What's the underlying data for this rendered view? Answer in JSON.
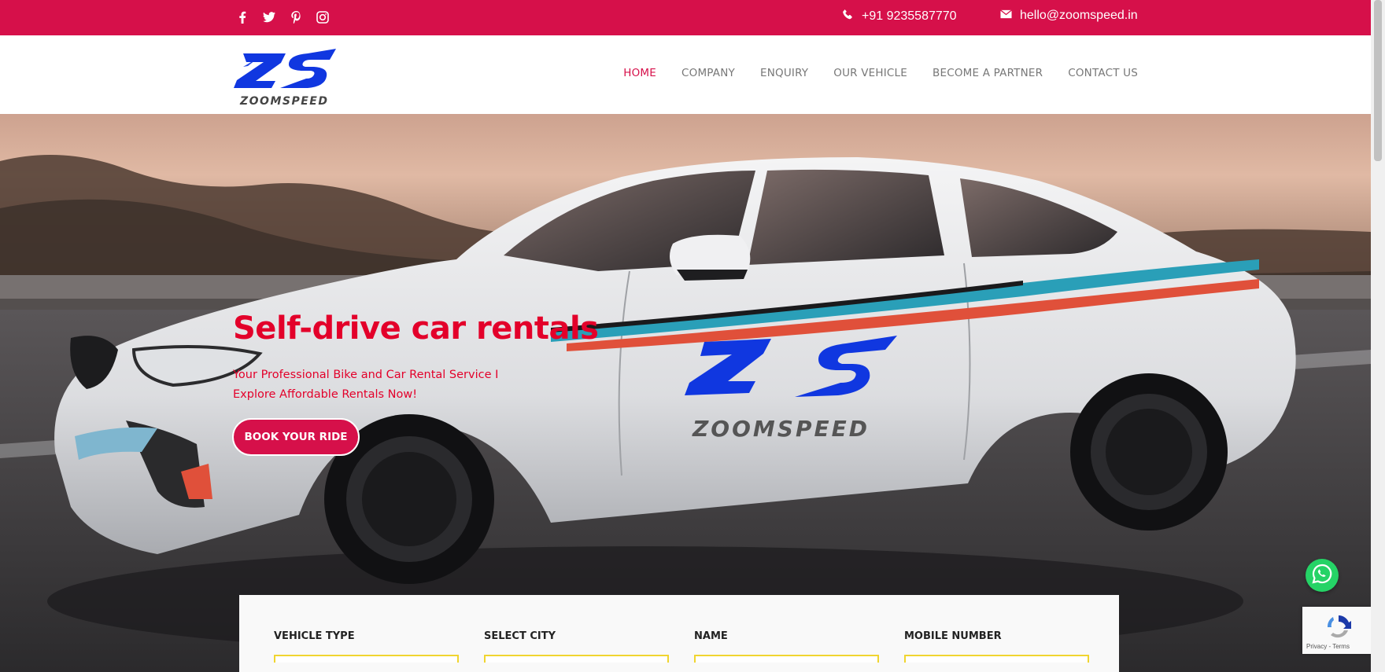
{
  "topbar": {
    "social": [
      {
        "name": "facebook-icon",
        "glyph": "f"
      },
      {
        "name": "twitter-icon",
        "glyph": ""
      },
      {
        "name": "pinterest-icon",
        "glyph": ""
      },
      {
        "name": "instagram-icon",
        "glyph": ""
      }
    ],
    "phone": "+91 9235587770",
    "email": "hello@zoomspeed.in"
  },
  "header": {
    "logo_mark": "ZS",
    "logo_wordmark": "ZOOMSPEED",
    "nav": [
      "HOME",
      "COMPANY",
      "ENQUIRY",
      "OUR VEHICLE",
      "BECOME A PARTNER",
      "CONTACT US"
    ],
    "active_nav": "HOME"
  },
  "hero": {
    "title": "Self-drive car rentals",
    "subtitle_line1": "Your Professional Bike and Car Rental Service I",
    "subtitle_line2": "Explore Affordable Rentals Now!",
    "cta": "BOOK YOUR RIDE",
    "car_logo_mark": "ZS",
    "car_logo_wordmark": "ZOOMSPEED"
  },
  "form": {
    "fields": [
      "VEHICLE TYPE",
      "SELECT CITY",
      "NAME",
      "MOBILE NUMBER"
    ]
  },
  "widgets": {
    "recaptcha_text": "Privacy - Terms"
  },
  "colors": {
    "brand_red": "#d6104a",
    "hero_text": "#e3002a",
    "logo_blue": "#1037e0",
    "input_border": "#f0d530"
  }
}
